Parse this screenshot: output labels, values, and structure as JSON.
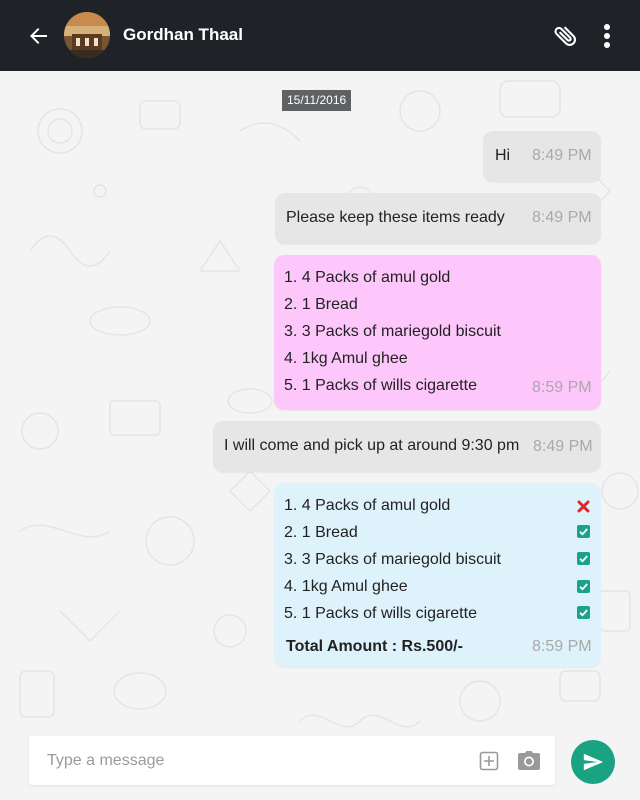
{
  "header": {
    "contact_name": "Gordhan Thaal",
    "back_icon": "back-arrow-icon",
    "attach_icon": "paperclip-icon",
    "menu_icon": "more-vertical-icon",
    "background_color": "#1f2328"
  },
  "date_separator": "15/11/2016",
  "messages": [
    {
      "text": "Hi",
      "time": "8:49 PM"
    },
    {
      "text": "Please keep these items ready",
      "time": "8:49 PM"
    },
    {
      "items": [
        "1. 4 Packs of amul gold",
        "2. 1 Bread",
        "3. 3 Packs of mariegold biscuit",
        "4. 1kg Amul ghee",
        "5. 1 Packs of wills cigarette"
      ],
      "time": "8:59 PM",
      "color": "#fdc7fb"
    },
    {
      "text": "I will come and pick up at around 9:30 pm",
      "time": "8:49 PM"
    },
    {
      "items": [
        {
          "label": "1. 4 Packs of amul gold",
          "status": "unavailable"
        },
        {
          "label": "2. 1 Bread",
          "status": "available"
        },
        {
          "label": "3. 3 Packs of mariegold biscuit",
          "status": "available"
        },
        {
          "label": "4. 1kg Amul ghee",
          "status": "available"
        },
        {
          "label": "5. 1 Packs of wills cigarette",
          "status": "available"
        }
      ],
      "total": "Total Amount : Rs.500/-",
      "time": "8:59 PM",
      "color": "#def2fb"
    }
  ],
  "composer": {
    "placeholder": "Type a message",
    "plus_icon": "add-box-icon",
    "camera_icon": "camera-icon",
    "send_icon": "send-icon",
    "send_color": "#1aa382"
  }
}
